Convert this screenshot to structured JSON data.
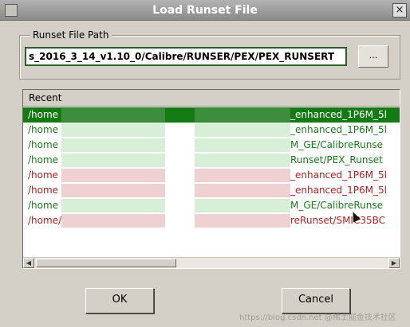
{
  "window": {
    "title": "Load Runset File",
    "close_glyph": "×"
  },
  "runset_path": {
    "group_label": "Runset File Path",
    "value": "s_2016_3_14_v1.10_0/Calibre/RUNSER/PEX/PEX_RUNSERT",
    "browse_label": "..."
  },
  "recent": {
    "header": "Recent",
    "rows": [
      {
        "start": "/home",
        "end": "_enhanced_1P6M_5l",
        "color": "selected"
      },
      {
        "start": "/home",
        "end": "_enhanced_1P6M_5l",
        "color": "green"
      },
      {
        "start": "/home",
        "end": "M_GE/CalibreRunse",
        "color": "green"
      },
      {
        "start": "/home",
        "end": "Runset/PEX_Runset",
        "color": "green"
      },
      {
        "start": "/home",
        "end": "_enhanced_1P6M_5l",
        "color": "red"
      },
      {
        "start": "/home",
        "end": "_enhanced_1P6M_5l",
        "color": "red"
      },
      {
        "start": "/home",
        "end": "M_GE/CalibreRunse",
        "color": "green"
      },
      {
        "start": "/home/",
        "end": "reRunset/SMIC35BC",
        "color": "red"
      }
    ]
  },
  "buttons": {
    "ok": "OK",
    "cancel": "Cancel"
  },
  "watermark": "https://blog.csdn.net @稀土掘金技术社区",
  "colors": {
    "selected_row": "#147a14",
    "green_text": "#1b7a1b",
    "red_text": "#b02020"
  }
}
